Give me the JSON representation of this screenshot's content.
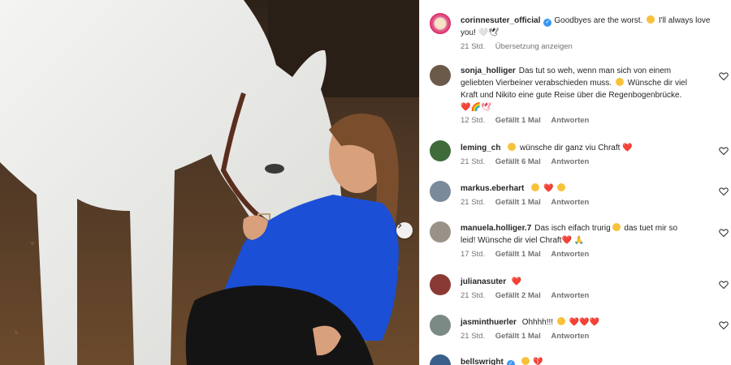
{
  "post": {
    "author": "corinnesuter_official",
    "caption": "Goodbyes are the worst.",
    "caption_2": "I'll always love you! 🤍🕊",
    "time": "21 Std.",
    "translate_label": "Übersetzung anzeigen"
  },
  "comments": [
    {
      "user": "sonja_holliger",
      "line1": "Das tut so weh, wenn man sich von einem",
      "line2": "geliebten Vierbeiner verabschieden muss.",
      "line2b": "Wünsche dir viel",
      "line3": "Kraft und Nikito eine gute Reise über die Regenbogenbrücke.",
      "line4": "❤️🌈🕊",
      "time": "12 Std.",
      "likes": "Gefällt 1 Mal",
      "reply": "Antworten"
    },
    {
      "user": "leming_ch",
      "text": "wünsche dir ganz viu Chraft ❤️",
      "time": "21 Std.",
      "likes": "Gefällt 6 Mal",
      "reply": "Antworten"
    },
    {
      "user": "markus.eberhart",
      "text": "❤️",
      "time": "21 Std.",
      "likes": "Gefällt 1 Mal",
      "reply": "Antworten"
    },
    {
      "user": "manuela.holliger.7",
      "line1": "Das isch eifach trurig",
      "line1b": "das tuet mir so",
      "line2": "leid! Wünsche dir viel Chraft❤️ 🙏",
      "time": "17 Std.",
      "likes": "Gefällt 1 Mal",
      "reply": "Antworten"
    },
    {
      "user": "julianasuter",
      "text": "❤️",
      "time": "21 Std.",
      "likes": "Gefällt 2 Mal",
      "reply": "Antworten"
    },
    {
      "user": "jasminthuerler",
      "text": "Ohhhh!!!",
      "text_b": "❤️❤️❤️",
      "time": "21 Std.",
      "likes": "Gefällt 1 Mal",
      "reply": "Antworten"
    },
    {
      "user": "bellswright",
      "text": "💔"
    }
  ],
  "icons": {
    "like": "heart-icon",
    "verified": "verified-badge-icon",
    "next": "chevron-right-icon"
  },
  "colors": {
    "accent_blue": "#3897f0",
    "heart_red": "#e0243b",
    "meta_gray": "#737373"
  }
}
